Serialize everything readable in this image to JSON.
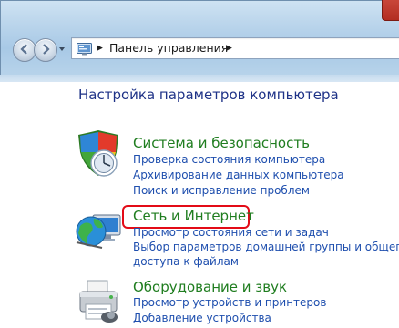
{
  "window": {
    "accent_color": "#c0392b"
  },
  "navigation": {
    "back_icon": "back-arrow-icon",
    "forward_icon": "forward-arrow-icon",
    "address_icon": "control-panel-icon",
    "breadcrumb_label": "Панель управления"
  },
  "main": {
    "heading": "Настройка параметров компьютера",
    "categories": [
      {
        "title": "Система и безопасность",
        "icon": "shield-icon",
        "links": [
          "Проверка состояния компьютера",
          "Архивирование данных компьютера",
          "Поиск и исправление проблем"
        ]
      },
      {
        "title": "Сеть и Интернет",
        "icon": "network-globe-icon",
        "highlighted": true,
        "links": [
          "Просмотр состояния сети и задач",
          "Выбор параметров домашней группы и общего",
          "доступа к файлам"
        ]
      },
      {
        "title": "Оборудование и звук",
        "icon": "printer-icon",
        "links": [
          "Просмотр устройств и принтеров",
          "Добавление устройства"
        ]
      }
    ]
  },
  "colors": {
    "category_title": "#1f7d1f",
    "link": "#1f4fae",
    "heading": "#1e3287",
    "highlight_ring": "#e30b17"
  }
}
